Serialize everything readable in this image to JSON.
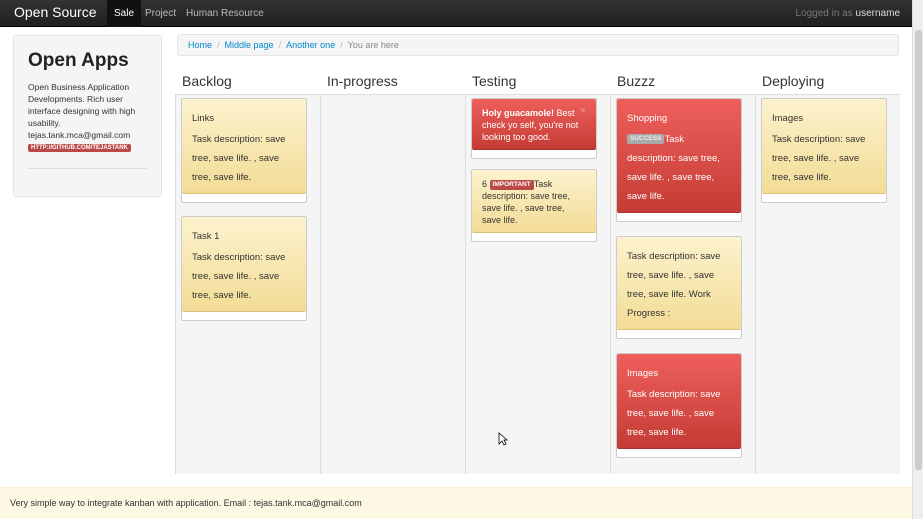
{
  "navbar": {
    "brand": "Open Source",
    "items": [
      {
        "label": "Sale",
        "active": true
      },
      {
        "label": "Project",
        "active": false
      },
      {
        "label": "Human Resource",
        "active": false
      }
    ],
    "logged_in_prefix": "Logged in as",
    "username": "username"
  },
  "sidebar": {
    "title": "Open Apps",
    "description": "Open Business Application Developments. Rich user interface designing with high usability.",
    "email": "tejas.tank.mca@gmail.com",
    "github_label": "HTTP://GITHUB.COM/TEJASTANK"
  },
  "breadcrumb": {
    "items": [
      "Home",
      "Middle page",
      "Another one"
    ],
    "current": "You are here"
  },
  "columns": [
    {
      "title": "Backlog"
    },
    {
      "title": "In-progress"
    },
    {
      "title": "Testing"
    },
    {
      "title": "Buzzz"
    },
    {
      "title": "Deploying"
    }
  ],
  "cards": {
    "backlog_links": {
      "title": "Links",
      "text": "Task description: save tree, save life. , save tree, save life."
    },
    "backlog_task1": {
      "title": "Task 1",
      "text": "Task description: save tree, save life. , save tree, save life."
    },
    "testing_alert": {
      "strong": "Holy guacamole!",
      "text": "Best check yo self, you're not looking too good.",
      "close": "×"
    },
    "testing_6": {
      "prefix": "6",
      "label": "IMPORTANT",
      "text": "Task description: save tree, save life. , save tree, save life."
    },
    "buzzz_shopping": {
      "title": "Shopping",
      "label": "SUCCESS",
      "text": "Task description: save tree, save life. , save tree, save life."
    },
    "buzzz_progress": {
      "text": "Task description: save tree, save life. , save tree, save life. Work Progress :"
    },
    "buzzz_images": {
      "title": "Images",
      "text": "Task description: save tree, save life. , save tree, save life."
    },
    "deploying_images": {
      "title": "Images",
      "text": "Task description: save tree, save life. , save tree, save life."
    }
  },
  "footer": {
    "text": "Very simple way to integrate kanban with application. Email : tejas.tank.mca@gmail.com"
  },
  "colors": {
    "navbar": "#222222",
    "card_yellow": "#f6e3a6",
    "card_red": "#d9534f",
    "link": "#0088cc",
    "footer_bg": "#fcf8e3"
  }
}
